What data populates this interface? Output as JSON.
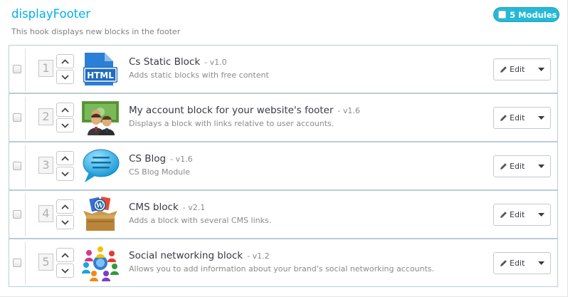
{
  "hook": {
    "title": "displayFooter",
    "description": "This hook displays new blocks in the footer",
    "modules_badge": "5 Modules"
  },
  "colors": {
    "accent": "#00aff0",
    "badge": "#25b9d7",
    "row_border": "#bbcdd2"
  },
  "modules": [
    {
      "position": "1",
      "name": "Cs Static Block",
      "version": "- v1.0",
      "description": "Adds static blocks with free content",
      "icon": "html-file-icon",
      "edit_label": "Edit"
    },
    {
      "position": "2",
      "name": "My account block for your website's footer",
      "version": "- v1.6",
      "description": "Displays a block with links relative to user accounts.",
      "icon": "users-money-icon",
      "edit_label": "Edit"
    },
    {
      "position": "3",
      "name": "CS Blog",
      "version": "- v1.6",
      "description": "CS Blog Module",
      "icon": "speech-bubble-icon",
      "edit_label": "Edit"
    },
    {
      "position": "4",
      "name": "CMS block",
      "version": "- v2.1",
      "description": "Adds a block with several CMS links.",
      "icon": "cms-box-icon",
      "edit_label": "Edit"
    },
    {
      "position": "5",
      "name": "Social networking block",
      "version": "- v1.2",
      "description": "Allows you to add information about your brand's social networking accounts.",
      "icon": "social-people-icon",
      "edit_label": "Edit"
    }
  ]
}
